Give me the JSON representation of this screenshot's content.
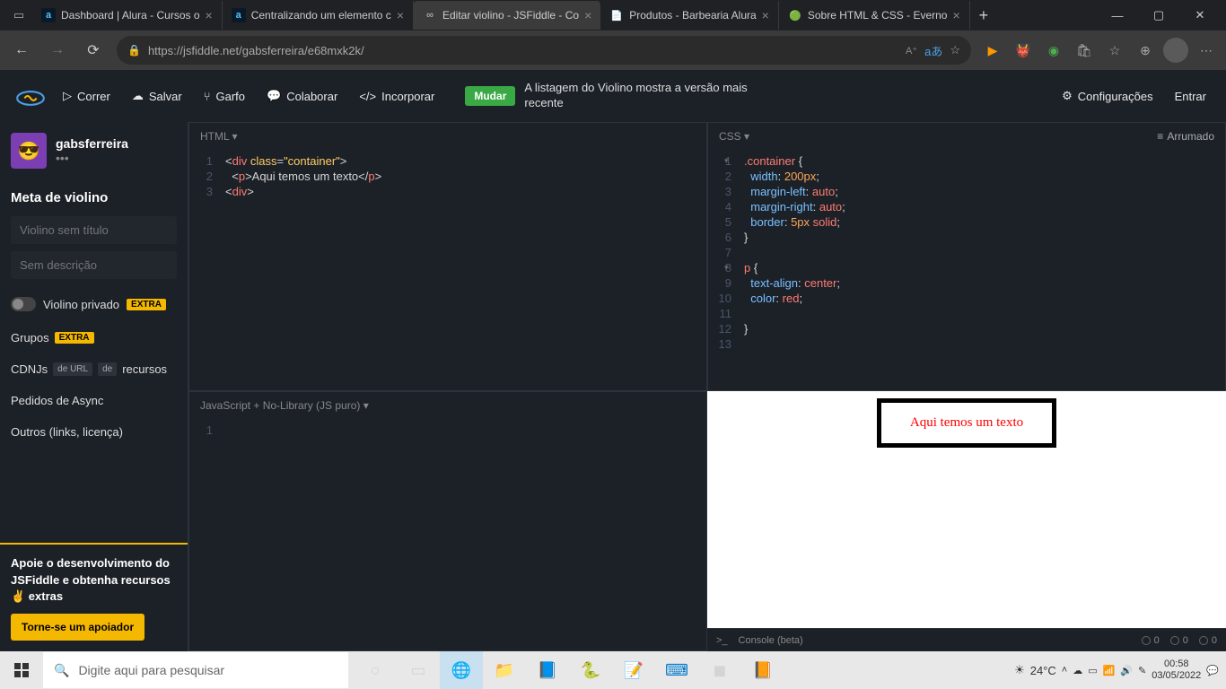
{
  "browser": {
    "tabs": [
      {
        "label": "Dashboard | Alura - Cursos o",
        "fav": "a"
      },
      {
        "label": "Centralizando um elemento c",
        "fav": "a"
      },
      {
        "label": "Editar violino - JSFiddle - Co",
        "fav": "∞",
        "active": true
      },
      {
        "label": "Produtos - Barbearia Alura",
        "fav": "📄"
      },
      {
        "label": "Sobre HTML & CSS - Everno",
        "fav": "🟢"
      }
    ],
    "url": "https://jsfiddle.net/gabsferreira/e68mxk2k/"
  },
  "header": {
    "run": "Correr",
    "save": "Salvar",
    "fork": "Garfo",
    "collaborate": "Colaborar",
    "embed": "Incorporar",
    "banner_btn": "Mudar",
    "banner_txt": "A listagem do Violino mostra a versão mais recente",
    "settings": "Configurações",
    "signin": "Entrar"
  },
  "sidebar": {
    "username": "gabsferreira",
    "meta_h": "Meta de violino",
    "title_ph": "Violino sem título",
    "desc_ph": "Sem descrição",
    "private": "Violino privado",
    "extra": "EXTRA",
    "groups": "Grupos",
    "cdnjs": "CDNJs",
    "cdn_url": "de URL",
    "cdn_de": "de",
    "resources": "recursos",
    "async": "Pedidos de Async",
    "others": "Outros (links, licença)",
    "promo_txt": "Apoie o desenvolvimento do JSFiddle e obtenha recursos ✌ extras",
    "promo_btn": "Torne-se um apoiador"
  },
  "panes": {
    "html_label": "HTML ▾",
    "css_label": "CSS ▾",
    "js_label": "JavaScript + No-Library (JS puro) ▾",
    "tidy": "Arrumado"
  },
  "html_code": [
    {
      "n": "1",
      "h": "<span class='t-pun'>&lt;</span><span class='t-tag'>div</span> <span class='t-attr'>class</span><span class='t-pun'>=</span><span class='t-str'>\"container\"</span><span class='t-pun'>&gt;</span>"
    },
    {
      "n": "2",
      "h": "  <span class='t-pun'>&lt;</span><span class='t-tag'>p</span><span class='t-pun'>&gt;</span><span class='t-txt'>Aqui temos um texto</span><span class='t-pun'>&lt;/</span><span class='t-tag'>p</span><span class='t-pun'>&gt;</span>"
    },
    {
      "n": "3",
      "h": "<span class='t-pun'>&lt;</span><span class='t-tag'>div</span><span class='t-pun'>&gt;</span>"
    }
  ],
  "css_code": [
    {
      "n": "1",
      "f": true,
      "h": "<span class='t-sel'>.container</span> <span class='t-pun'>{</span>"
    },
    {
      "n": "2",
      "h": "  <span class='t-prop'>width</span><span class='t-pun'>:</span> <span class='t-val'>200px</span><span class='t-pun'>;</span>"
    },
    {
      "n": "3",
      "h": "  <span class='t-prop'>margin-left</span><span class='t-pun'>:</span> <span class='t-kw'>auto</span><span class='t-pun'>;</span>"
    },
    {
      "n": "4",
      "h": "  <span class='t-prop'>margin-right</span><span class='t-pun'>:</span> <span class='t-kw'>auto</span><span class='t-pun'>;</span>"
    },
    {
      "n": "5",
      "h": "  <span class='t-prop'>border</span><span class='t-pun'>:</span> <span class='t-val'>5px</span> <span class='t-kw'>solid</span><span class='t-pun'>;</span>"
    },
    {
      "n": "6",
      "h": "<span class='t-pun'>}</span>"
    },
    {
      "n": "7",
      "h": ""
    },
    {
      "n": "8",
      "f": true,
      "h": "<span class='t-sel'>p</span> <span class='t-pun'>{</span>"
    },
    {
      "n": "9",
      "h": "  <span class='t-prop'>text-align</span><span class='t-pun'>:</span> <span class='t-kw'>center</span><span class='t-pun'>;</span>"
    },
    {
      "n": "10",
      "h": "  <span class='t-prop'>color</span><span class='t-pun'>:</span> <span class='t-kw'>red</span><span class='t-pun'>;</span>"
    },
    {
      "n": "11",
      "h": ""
    },
    {
      "n": "12",
      "h": "<span class='t-pun'>}</span>"
    },
    {
      "n": "13",
      "h": ""
    }
  ],
  "js_code": [
    {
      "n": "1",
      "h": ""
    }
  ],
  "result": {
    "text": "Aqui temos um texto"
  },
  "console": {
    "label": "Console (beta)",
    "stats": [
      "0",
      "0",
      "0"
    ]
  },
  "taskbar": {
    "search_ph": "Digite aqui para pesquisar",
    "weather": "24°C",
    "time": "00:58",
    "date": "03/05/2022"
  }
}
